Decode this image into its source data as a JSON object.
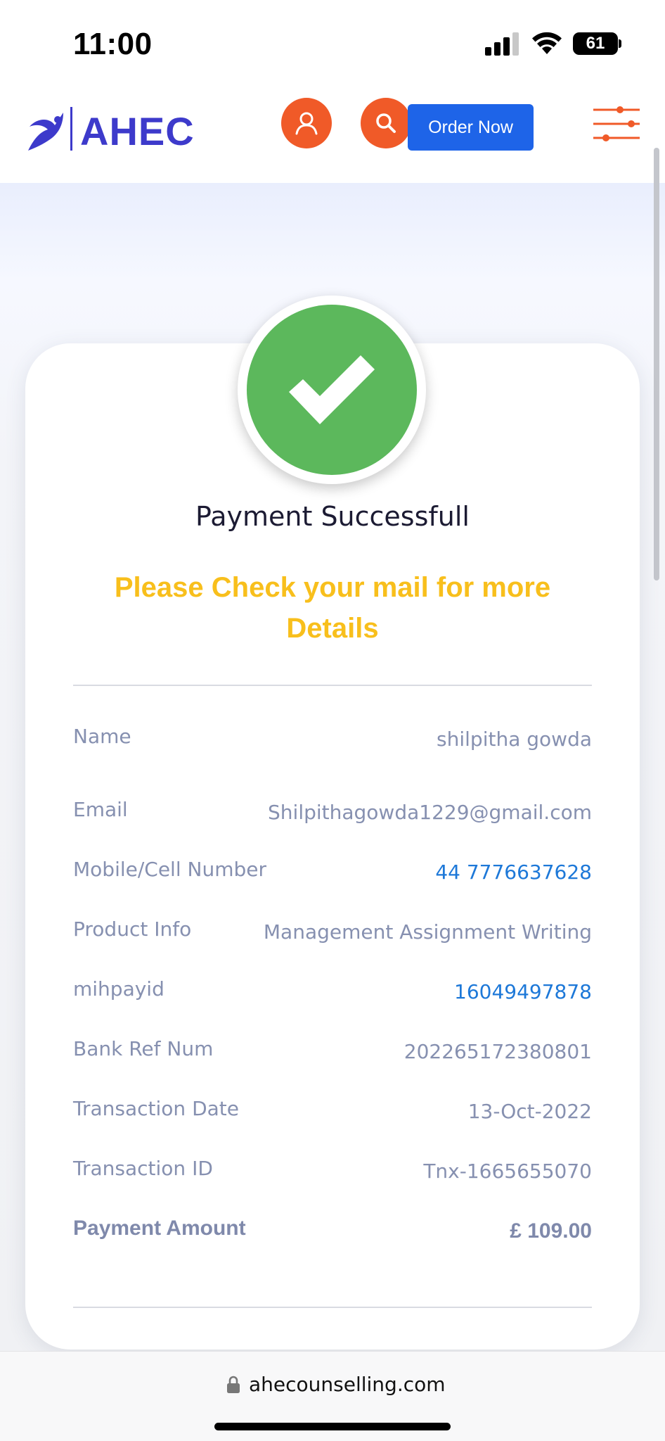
{
  "status_bar": {
    "time": "11:00",
    "battery": "61",
    "icons": [
      "cellular-signal-icon",
      "wifi-icon",
      "battery-icon"
    ]
  },
  "header": {
    "logo_text": "AHEC",
    "user_icon": "user-icon",
    "search_icon": "search-icon",
    "order_button": "Order Now",
    "menu_icon": "sliders-menu-icon",
    "accent_color": "#f05a28",
    "brand_color": "#3d3acb",
    "order_button_color": "#1e64e8"
  },
  "confirmation": {
    "icon": "check-icon",
    "title": "Payment Successfull",
    "note": "Please Check your mail for more Details",
    "success_color": "#5cb85c",
    "note_color": "#f8bf1c"
  },
  "details": [
    {
      "label": "Name",
      "value": "shilpitha gowda"
    },
    {
      "label": "Email",
      "value": "Shilpithagowda1229@gmail.com"
    },
    {
      "label": "Mobile/Cell Number",
      "value": "44 7776637628"
    },
    {
      "label": "Product Info",
      "value": "Management Assignment Writing"
    },
    {
      "label": "mihpayid",
      "value": "16049497878"
    },
    {
      "label": "Bank Ref Num",
      "value": "202265172380801"
    },
    {
      "label": "Transaction Date",
      "value": "13-Oct-2022"
    },
    {
      "label": "Transaction ID",
      "value": "Tnx-1665655070"
    },
    {
      "label": "Payment Amount",
      "value": "£ 109.00"
    }
  ],
  "browser": {
    "url": "ahecounselling.com",
    "lock_icon": "lock-icon"
  }
}
